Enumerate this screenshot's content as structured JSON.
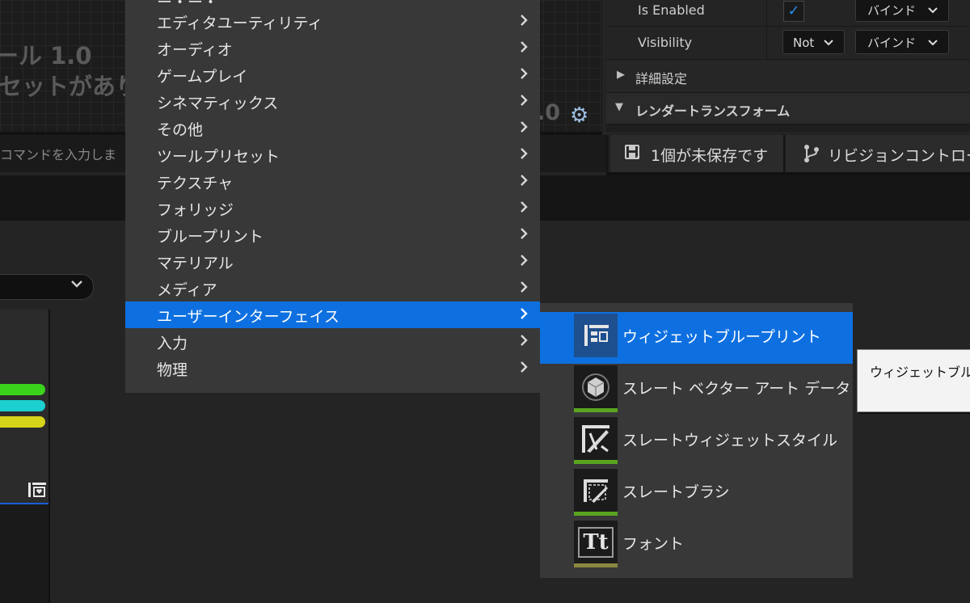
{
  "viewport": {
    "title_fragment": "ール 1.0",
    "subtitle_fragment": "セットがあり",
    "zoom_fragment": ".0"
  },
  "command_bar": {
    "placeholder": "コマンドを入力しま"
  },
  "status_bar": {
    "unsaved_label": "1個が未保存です",
    "revision_label": "リビジョンコントロー"
  },
  "details": {
    "is_enabled_label": "Is Enabled",
    "is_enabled_checked": "✓",
    "bind_label": "バインド",
    "visibility_label": "Visibility",
    "visibility_value": "Not",
    "advanced_label": "詳細設定",
    "render_transform_label": "レンダートランスフォーム"
  },
  "menu": {
    "items": [
      {
        "label": "エディタユーティリティ"
      },
      {
        "label": "オーディオ"
      },
      {
        "label": "ゲームプレイ"
      },
      {
        "label": "シネマティックス"
      },
      {
        "label": "その他"
      },
      {
        "label": "ツールプリセット"
      },
      {
        "label": "テクスチャ"
      },
      {
        "label": "フォリッジ"
      },
      {
        "label": "ブループリント"
      },
      {
        "label": "マテリアル"
      },
      {
        "label": "メディア"
      },
      {
        "label": "ユーザーインターフェイス"
      },
      {
        "label": "入力"
      },
      {
        "label": "物理"
      }
    ],
    "selected_index": 11,
    "arrow": "›"
  },
  "submenu": {
    "items": [
      {
        "label": "ウィジェットブループリント",
        "icon": "widget-blueprint-icon"
      },
      {
        "label": "スレート ベクター アート データ",
        "icon": "vector-art-cube-icon"
      },
      {
        "label": "スレートウィジェットスタイル",
        "icon": "widget-style-brush-icon"
      },
      {
        "label": "スレートブラシ",
        "icon": "slate-brush-icon"
      },
      {
        "label": "フォント",
        "icon": "font-icon"
      }
    ],
    "selected_index": 0,
    "font_icon_text": "Tt"
  },
  "tooltip": {
    "text": "ウィジェットブル"
  },
  "colors": {
    "menu_bg": "#383838",
    "selection": "#0e70e0",
    "asset_bar_green": "#5aa51f",
    "asset_bar_olive": "#8a8740"
  }
}
